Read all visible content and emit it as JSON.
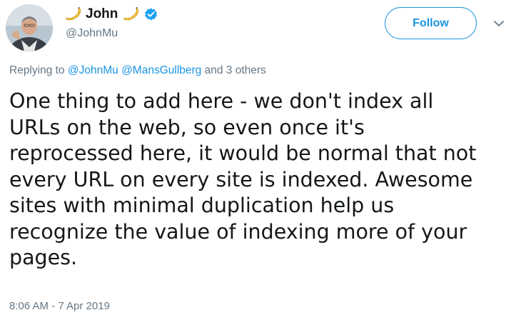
{
  "user": {
    "display_name": "John",
    "handle": "@JohnMu",
    "verified": true,
    "name_emoji": "banana-icon",
    "avatar": "avatar-photo"
  },
  "follow_button": {
    "label": "Follow"
  },
  "menu_caret": {
    "icon": "chevron-down-icon"
  },
  "reply_context": {
    "prefix": "Replying to",
    "mentions": [
      "@JohnMu",
      "@MansGullberg"
    ],
    "others": "and 3 others"
  },
  "tweet": {
    "lines": [
      "One thing to add here - we don't index all",
      "URLs on the web, so even once it's",
      "reprocessed here, it would be normal that not",
      "every URL on every site is indexed. Awesome",
      "sites with minimal duplication help us",
      "recognize the value of indexing more of your",
      "pages."
    ],
    "timestamp": "8:06 AM - 7 Apr 2019"
  },
  "colors": {
    "accent": "#1b95e0",
    "secondary_text": "#657786",
    "primary_text": "#14171a",
    "verified": "#1da1f2"
  }
}
